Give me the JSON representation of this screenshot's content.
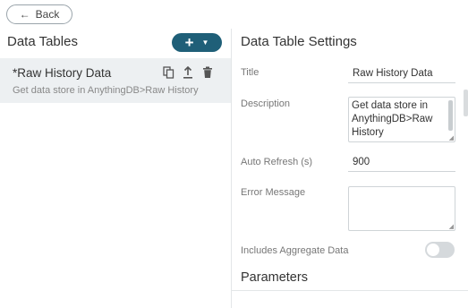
{
  "nav": {
    "back_label": "Back"
  },
  "left": {
    "title": "Data Tables",
    "add_icon": "plus-icon",
    "items": [
      {
        "name": "*Raw History Data",
        "description": "Get data store in AnythingDB>Raw History",
        "actions": [
          "copy-icon",
          "upload-icon",
          "trash-icon"
        ]
      }
    ]
  },
  "settings": {
    "title": "Data Table Settings",
    "title_label": "Title",
    "title_value": "Raw History Data",
    "description_label": "Description",
    "description_value": "Get data store in AnythingDB>Raw History",
    "auto_refresh_label": "Auto Refresh (s)",
    "auto_refresh_value": "900",
    "error_message_label": "Error Message",
    "error_message_value": "",
    "aggregate_label": "Includes Aggregate Data",
    "aggregate_enabled": false
  },
  "parameters": {
    "title": "Parameters"
  },
  "colors": {
    "accent": "#1f5f78",
    "selected_row": "#edf0f2",
    "toggle_off": "#d5d9dc"
  }
}
